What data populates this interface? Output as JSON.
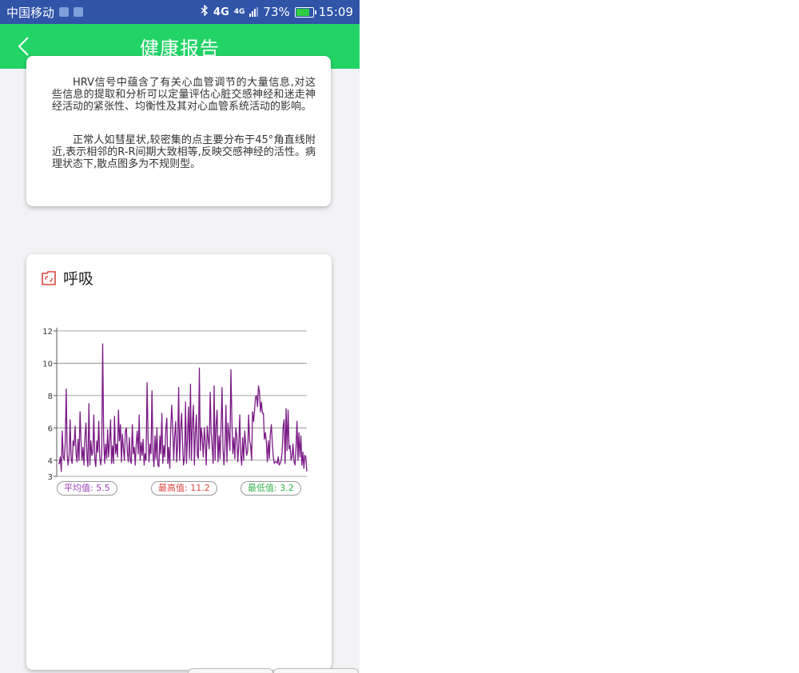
{
  "status_bar": {
    "carrier": "中国移动",
    "network_1": "4G",
    "network_2": "4G",
    "battery": "73%",
    "time": "15:09",
    "icons": [
      "notification-icon",
      "image-icon",
      "bluetooth-icon",
      "signal-icon",
      "battery-icon"
    ]
  },
  "app_bar": {
    "title": "健康报告",
    "back_icon": "chevron-left-icon"
  },
  "hrv_text": {
    "paragraph_1": "HRV信号中蕴含了有关心血管调节的大量信息,对这些信息的提取和分析可以定量评估心脏交感神经和迷走神经活动的紧张性、均衡性及其对心血管系统活动的影响。",
    "paragraph_2": "正常人如彗星状,较密集的点主要分布于45°角直线附近,表示相邻的R-R间期大致相等,反映交感神经的活性。病理状态下,散点图多为不规则型。"
  },
  "breath_card": {
    "title": "呼吸",
    "icon": "breath-icon",
    "avg_label": "平均值:",
    "avg_value": "5.5",
    "max_label": "最高值:",
    "max_value": "11.2",
    "min_label": "最低值:",
    "min_value": "3.2"
  },
  "colors": {
    "status_bar": "#2f54a8",
    "app_bar": "#22d366",
    "line": "#7b1a86",
    "avg": "#9b3fb6",
    "max": "#d9473f",
    "min": "#36b34b"
  },
  "chart_data": {
    "type": "line",
    "title": "呼吸",
    "xlabel": "",
    "ylabel": "",
    "ylim": [
      3,
      12
    ],
    "y_ticks": [
      "3",
      "4",
      "6",
      "8",
      "10",
      "12"
    ],
    "grid": true,
    "series": [
      {
        "values": [
          3.8,
          3.8,
          4.2,
          3.3,
          5.8,
          4.2,
          4.0,
          5.0,
          8.4,
          4.3,
          3.7,
          4.4,
          6.5,
          4.1,
          3.8,
          5.2,
          4.9,
          6.1,
          4.4,
          3.9,
          5.3,
          4.0,
          7.0,
          5.2,
          4.0,
          4.8,
          3.7,
          5.4,
          6.3,
          4.2,
          3.6,
          7.5,
          3.7,
          5.2,
          4.3,
          4.5,
          6.8,
          4.0,
          3.6,
          5.2,
          4.5,
          6.4,
          4.2,
          3.7,
          4.4,
          11.2,
          5.2,
          3.8,
          5.0,
          4.1,
          5.9,
          4.2,
          5.2,
          6.5,
          3.8,
          4.9,
          3.8,
          6.7,
          4.4,
          5.0,
          4.2,
          7.1,
          5.2,
          6.2,
          3.9,
          5.6,
          4.7,
          4.0,
          5.8,
          6.0,
          4.5,
          3.9,
          5.4,
          4.0,
          3.8,
          6.2,
          4.4,
          4.8,
          3.7,
          5.0,
          5.8,
          4.4,
          6.8,
          4.0,
          5.1,
          4.3,
          5.3,
          3.7,
          4.4,
          4.0,
          8.8,
          5.4,
          3.9,
          5.0,
          4.4,
          8.3,
          4.4,
          3.6,
          5.5,
          4.1,
          6.0,
          3.7,
          3.6,
          5.5,
          4.4,
          6.9,
          3.8,
          4.9,
          4.2,
          5.9,
          6.6,
          3.8,
          4.8,
          3.5,
          6.0,
          7.4,
          6.0,
          4.0,
          5.5,
          6.4,
          3.9,
          4.9,
          8.5,
          4.0,
          5.9,
          6.9,
          5.0,
          3.7,
          4.2,
          7.6,
          3.8,
          5.5,
          7.3,
          4.1,
          8.7,
          4.0,
          6.3,
          7.4,
          3.7,
          5.7,
          6.8,
          4.3,
          4.1,
          9.7,
          4.6,
          6.0,
          5.3,
          4.2,
          6.0,
          5.1,
          3.7,
          6.1,
          5.3,
          4.7,
          8.2,
          5.7,
          4.9,
          3.8,
          8.6,
          4.0,
          6.2,
          7.1,
          3.9,
          5.5,
          4.1,
          5.9,
          8.5,
          4.7,
          3.7,
          4.9,
          7.4,
          3.9,
          6.3,
          5.6,
          4.6,
          9.6,
          6.5,
          4.4,
          5.4,
          4.1,
          6.0,
          5.5,
          3.9,
          4.9,
          6.8,
          4.3,
          3.7,
          5.4,
          4.0,
          5.8,
          5.0,
          4.3,
          4.6,
          6.8,
          5.2,
          4.9,
          4.0,
          7.0,
          6.4,
          7.1,
          7.9,
          8.0,
          7.3,
          8.6,
          8.2,
          7.0,
          7.6,
          6.9,
          6.9,
          5.3,
          5.7,
          5.1,
          3.9,
          5.2,
          4.1,
          5.6,
          6.2,
          5.1,
          4.2,
          3.8,
          3.9,
          3.9,
          3.8,
          4.2,
          3.7,
          3.8,
          4.0,
          4.5,
          6.1,
          6.5,
          3.8,
          7.2,
          4.6,
          7.1,
          4.7,
          4.9,
          4.0,
          4.2,
          5.0,
          3.9,
          3.7,
          4.7,
          6.4,
          4.0,
          5.7,
          4.2,
          5.5,
          3.7,
          4.5,
          3.5,
          4.3,
          4.2,
          3.3
        ]
      }
    ]
  }
}
